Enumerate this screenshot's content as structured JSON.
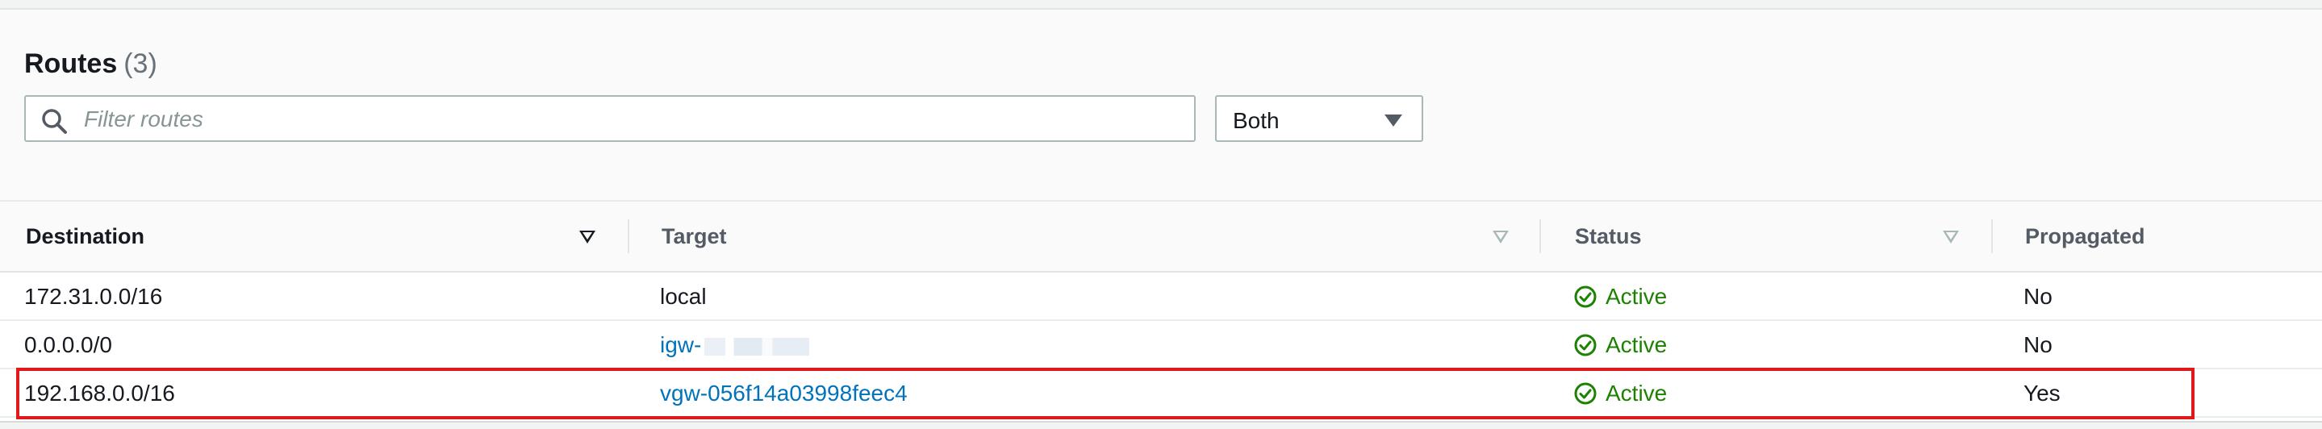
{
  "routes_panel": {
    "title": "Routes",
    "count": "(3)",
    "filter_placeholder": "Filter routes",
    "filter_value": "",
    "propagation_select": "Both"
  },
  "table": {
    "columns": [
      "Destination",
      "Target",
      "Status",
      "Propagated"
    ],
    "rows": [
      {
        "destination": "172.31.0.0/16",
        "target": "local",
        "target_is_link": false,
        "status": "Active",
        "propagated": "No"
      },
      {
        "destination": "0.0.0.0/0",
        "target": "igw-",
        "target_is_link": true,
        "target_redacted": true,
        "status": "Active",
        "propagated": "No"
      },
      {
        "destination": "192.168.0.0/16",
        "target": "vgw-056f14a03998feec4",
        "target_is_link": true,
        "status": "Active",
        "propagated": "Yes",
        "highlighted": true
      }
    ]
  },
  "colors": {
    "link": "#0073bb",
    "status_active": "#1d8102",
    "highlight_border": "#e0191a"
  },
  "icons": {
    "search": "search-icon",
    "sort": "sort-descending-icon",
    "status": "check-circle-icon",
    "dropdown": "caret-down-icon"
  }
}
